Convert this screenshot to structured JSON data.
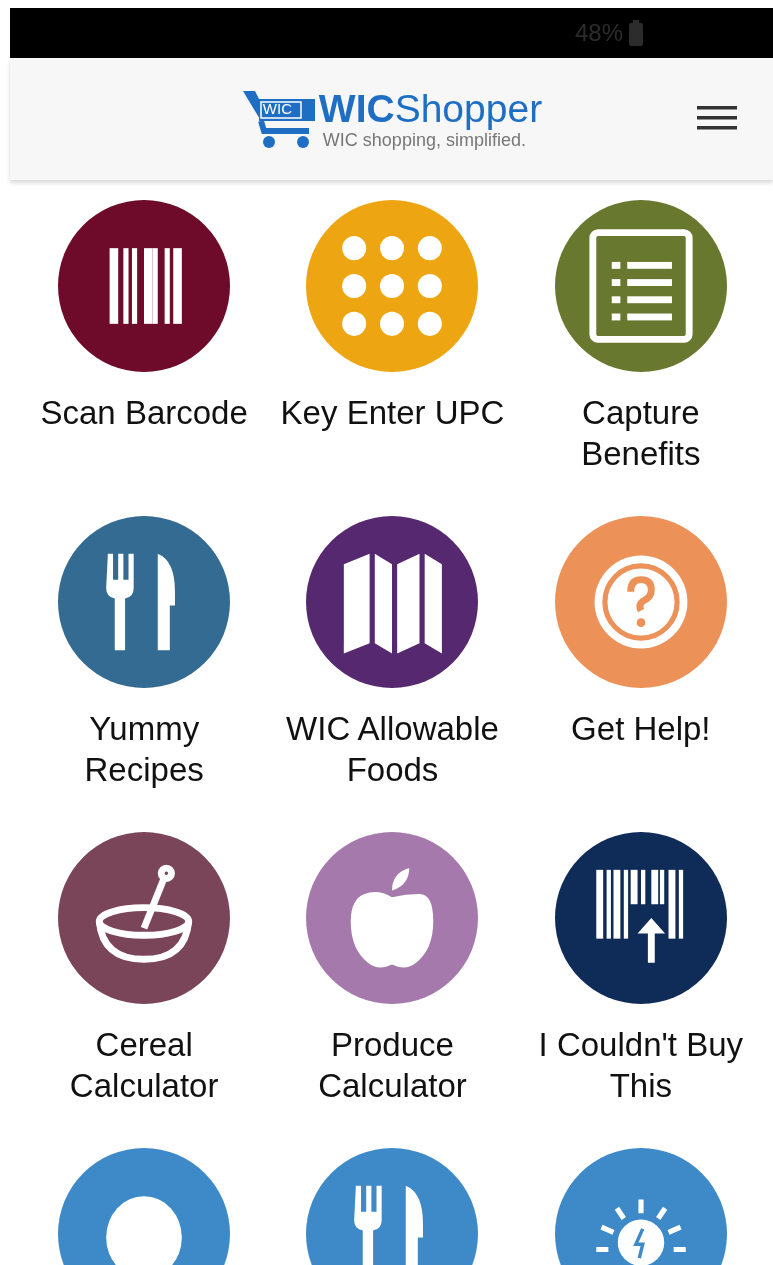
{
  "status_bar": {
    "battery": "48%"
  },
  "header": {
    "logo_badge": "WIC",
    "logo_bold": "WIC",
    "logo_rest": "Shopper",
    "tagline": "WIC shopping, simplified."
  },
  "tiles": [
    {
      "kind": "barcode",
      "color": "#6e0b2a",
      "label": "Scan Barcode"
    },
    {
      "kind": "keypad",
      "color": "#eda512",
      "label": "Key Enter UPC"
    },
    {
      "kind": "list",
      "color": "#69782f",
      "label": "Capture Benefits"
    },
    {
      "kind": "utensils",
      "color": "#336b92",
      "label": "Yummy Recipes"
    },
    {
      "kind": "map",
      "color": "#552870",
      "label": "WIC Allowable Foods"
    },
    {
      "kind": "help",
      "color": "#ec9158",
      "label": "Get Help!"
    },
    {
      "kind": "bowl",
      "color": "#7a4559",
      "label": "Cereal Calculator"
    },
    {
      "kind": "apple",
      "color": "#a679ad",
      "label": "Produce Calculator"
    },
    {
      "kind": "upload",
      "color": "#0f2b57",
      "label": "I Couldn't Buy This"
    },
    {
      "kind": "bubble",
      "color": "#3e8ac8"
    },
    {
      "kind": "utensils",
      "color": "#3e8ac8"
    },
    {
      "kind": "bulb",
      "color": "#3e8ac8"
    }
  ]
}
